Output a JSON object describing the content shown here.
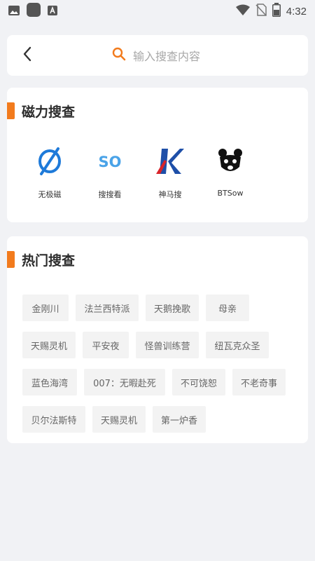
{
  "status_bar": {
    "time": "4:32",
    "icons": [
      "image-icon",
      "app-icon",
      "font-icon",
      "wifi-icon",
      "no-sim-icon",
      "battery-icon"
    ]
  },
  "search": {
    "placeholder": "输入搜查内容",
    "accent_color": "#f27b1d"
  },
  "magnet_section": {
    "title": "磁力搜查",
    "engines": [
      {
        "label": "无极磁",
        "icon": "empty-set-logo-icon"
      },
      {
        "label": "搜搜看",
        "icon": "so-logo-icon"
      },
      {
        "label": "神马搜",
        "icon": "k-logo-icon"
      },
      {
        "label": "BTSow",
        "icon": "btsow-logo-icon"
      }
    ]
  },
  "hot_section": {
    "title": "热门搜查",
    "rows": [
      [
        "金刚川",
        "法兰西特派",
        "天鹅挽歌",
        "母亲"
      ],
      [
        "天赐灵机",
        "平安夜",
        "怪兽训练营",
        "纽瓦克众圣"
      ],
      [
        "蓝色海湾",
        "007：无暇赴死",
        "不可饶恕",
        "不老奇事"
      ],
      [
        "贝尔法斯特",
        "天赐灵机",
        "第一炉香"
      ]
    ]
  },
  "colors": {
    "background": "#f1f2f5",
    "accent": "#f27b1d",
    "engine_blue": "#1e7ad9",
    "engine_red": "#d8242a"
  }
}
